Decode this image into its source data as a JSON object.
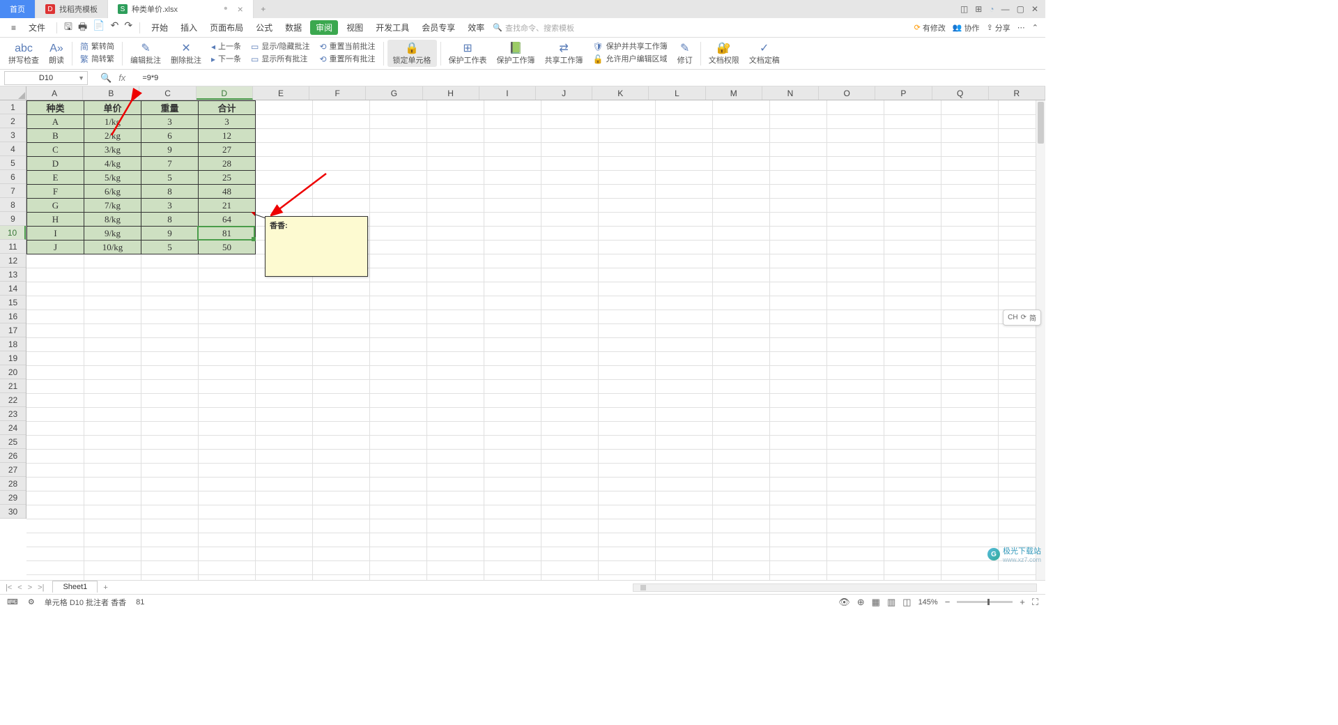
{
  "tabs": {
    "home": "首页",
    "docer": "找稻壳模板",
    "file": "种类单价.xlsx"
  },
  "menu": {
    "file": "文件",
    "items": [
      "开始",
      "插入",
      "页面布局",
      "公式",
      "数据",
      "审阅",
      "视图",
      "开发工具",
      "会员专享",
      "效率"
    ],
    "active": "审阅",
    "search_hint": "查找命令、搜索模板"
  },
  "menu_right": {
    "unsaved": "有修改",
    "coop": "协作",
    "share": "分享"
  },
  "ribbon": {
    "spellcheck": "拼写检查",
    "read": "朗读",
    "fzj": "繁转简",
    "jzf": "简转繁",
    "edit_comment": "编辑批注",
    "del_comment": "删除批注",
    "prev": "上一条",
    "next": "下一条",
    "show_hide": "显示/隐藏批注",
    "show_all": "显示所有批注",
    "reset_cur": "重置当前批注",
    "reset_all": "重置所有批注",
    "lock_cell": "锁定单元格",
    "protect_sheet": "保护工作表",
    "protect_book": "保护工作簿",
    "share_book": "共享工作簿",
    "protect_share": "保护并共享工作簿",
    "allow_edit": "允许用户编辑区域",
    "track": "修订",
    "perm": "文档权限",
    "finalize": "文档定稿"
  },
  "cell_ref": "D10",
  "formula": "=9*9",
  "columns": [
    "A",
    "B",
    "C",
    "D",
    "E",
    "F",
    "G",
    "H",
    "I",
    "J",
    "K",
    "L",
    "M",
    "N",
    "O",
    "P",
    "Q",
    "R"
  ],
  "sel_col": "D",
  "sel_row": 10,
  "table": {
    "headers": [
      "种类",
      "单价",
      "重量",
      "合计"
    ],
    "rows": [
      [
        "A",
        "1/kg",
        "3",
        "3"
      ],
      [
        "B",
        "2/kg",
        "6",
        "12"
      ],
      [
        "C",
        "3/kg",
        "9",
        "27"
      ],
      [
        "D",
        "4/kg",
        "7",
        "28"
      ],
      [
        "E",
        "5/kg",
        "5",
        "25"
      ],
      [
        "F",
        "6/kg",
        "8",
        "48"
      ],
      [
        "G",
        "7/kg",
        "3",
        "21"
      ],
      [
        "H",
        "8/kg",
        "8",
        "64"
      ],
      [
        "I",
        "9/kg",
        "9",
        "81"
      ],
      [
        "J",
        "10/kg",
        "5",
        "50"
      ]
    ]
  },
  "comment_author": "香香:",
  "sheet_name": "Sheet1",
  "status": {
    "cell_info": "单元格 D10 批注者 香香",
    "value": "81",
    "zoom": "145%"
  },
  "float_badge": {
    "a": "CH",
    "b": "简"
  },
  "watermark": {
    "brand": "极光下载站",
    "url": "www.xz7.com"
  }
}
